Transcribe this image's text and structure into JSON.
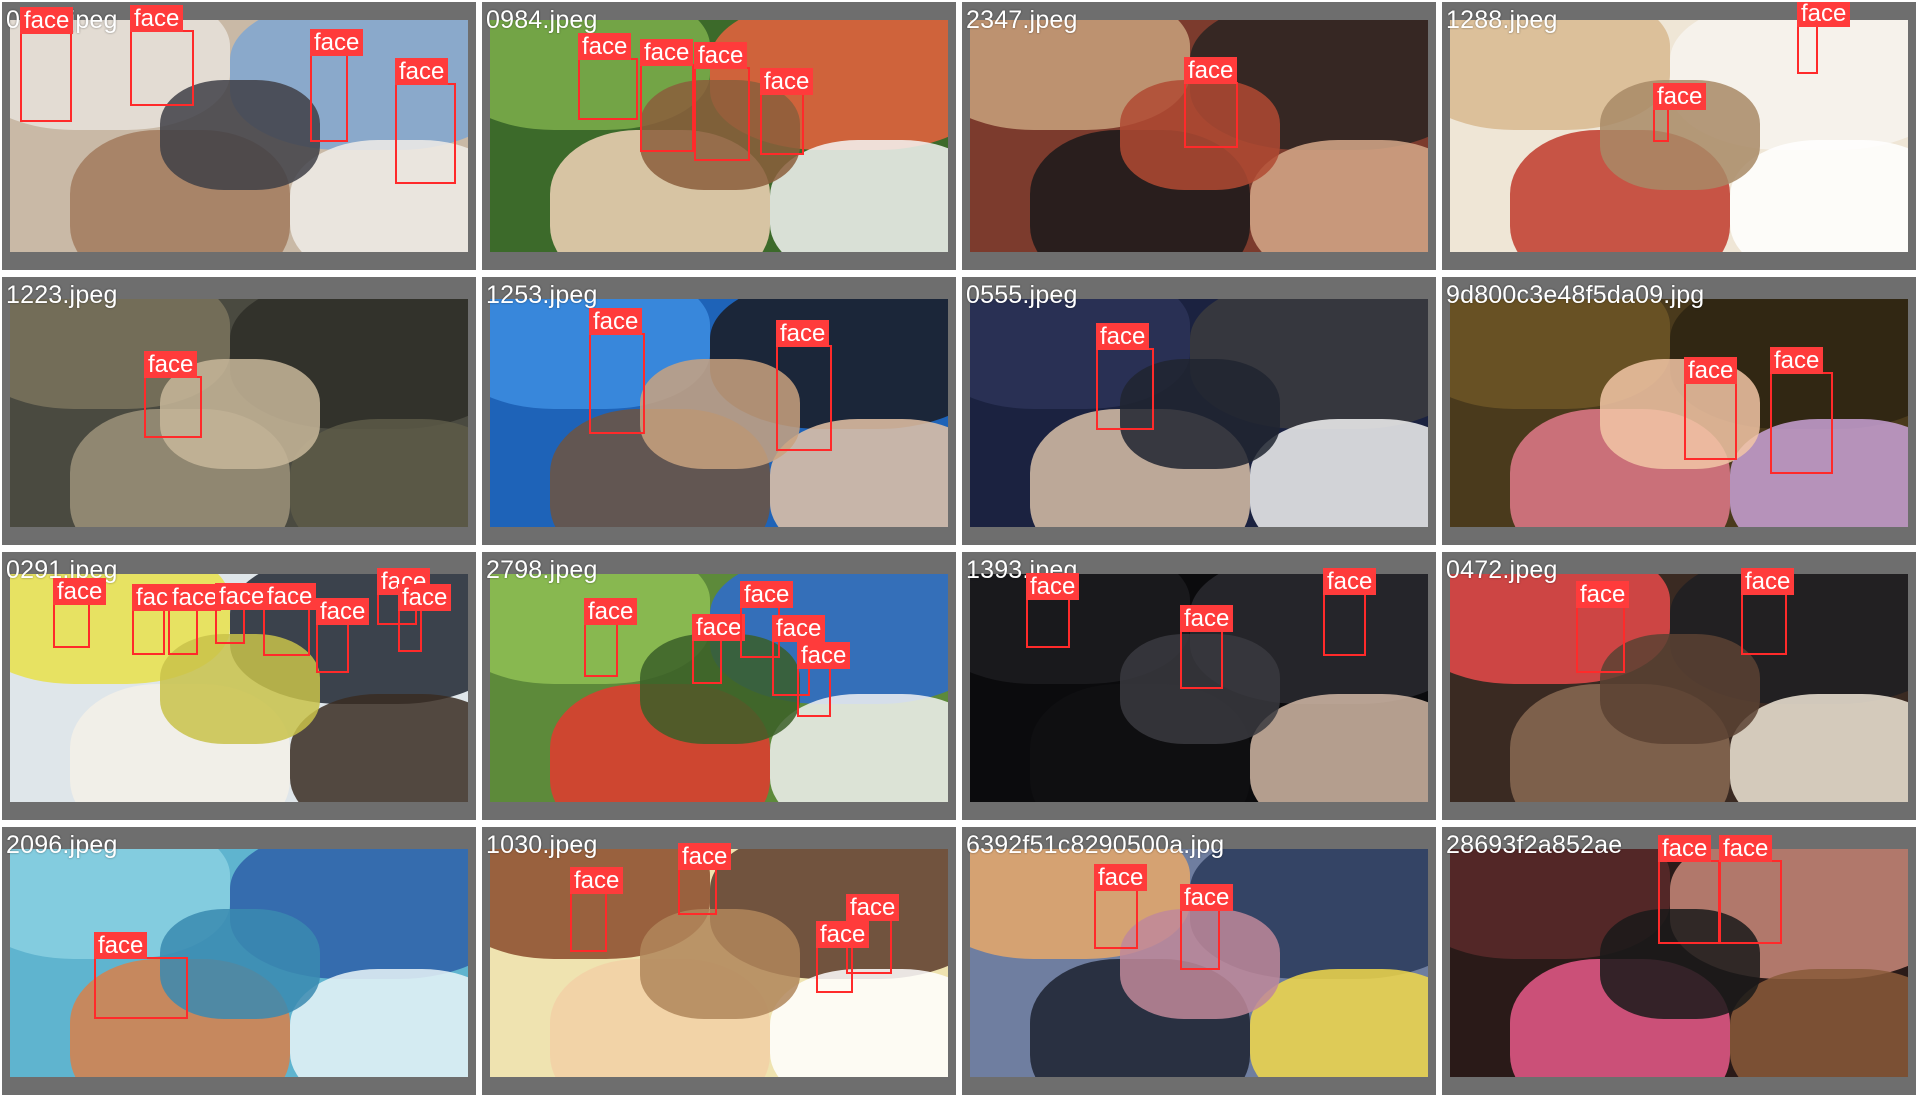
{
  "colors": {
    "frame": "#6e6e6e",
    "box": "#ff2a2a",
    "label_bg": "#ff3b3b",
    "label_text": "#ffffff"
  },
  "tiles": [
    {
      "filename": "0138.jpeg",
      "label": "face",
      "faces": 4,
      "scene": {
        "base": "#c9b9a6",
        "layers": [
          "#e8e2da",
          "#7fa6d1",
          "#a27a5d",
          "#f0ece7",
          "#3f3f46"
        ]
      }
    },
    {
      "filename": "0984.jpeg",
      "label": "face",
      "faces": 4,
      "scene": {
        "base": "#3c6a2a",
        "layers": [
          "#7cae4b",
          "#e9623e",
          "#f2d3b8",
          "#f4f4f4",
          "#8b5e3c"
        ]
      }
    },
    {
      "filename": "2347.jpeg",
      "label": "face",
      "faces": 1,
      "scene": {
        "base": "#7c3b2d",
        "layers": [
          "#c9a27d",
          "#2a2422",
          "#1b1a1b",
          "#d6a98a",
          "#b04a32"
        ]
      }
    },
    {
      "filename": "1288.jpeg",
      "label": "face",
      "faces": 2,
      "scene": {
        "base": "#efe6d6",
        "layers": [
          "#d8b98f",
          "#f7f3ee",
          "#c0392b",
          "#ffffff",
          "#a88a66"
        ]
      }
    },
    {
      "filename": "1223.jpeg",
      "label": "face",
      "faces": 1,
      "scene": {
        "base": "#4a4a40",
        "layers": [
          "#7a735d",
          "#2e2e28",
          "#9c927a",
          "#5d5a48",
          "#c8b79a"
        ]
      }
    },
    {
      "filename": "1253.jpeg",
      "label": "face",
      "faces": 2,
      "scene": {
        "base": "#1e63b8",
        "layers": [
          "#3d8de0",
          "#1b1b22",
          "#6e5440",
          "#e5c3a6",
          "#c9a27f"
        ]
      }
    },
    {
      "filename": "0555.jpeg",
      "label": "face",
      "faces": 1,
      "scene": {
        "base": "#1b2240",
        "layers": [
          "#2b3358",
          "#3b3b3e",
          "#d8c0a8",
          "#f2f2f2",
          "#202430"
        ]
      }
    },
    {
      "filename": "9d800c3e48f5da09.jpg",
      "label": "face",
      "faces": 2,
      "scene": {
        "base": "#4a3a1c",
        "layers": [
          "#6d5626",
          "#2d2412",
          "#e07a8a",
          "#c9a2d6",
          "#f2c6a6"
        ]
      }
    },
    {
      "filename": "0291.jpeg",
      "label": "face",
      "faces": 9,
      "scene": {
        "base": "#dfe6ea",
        "layers": [
          "#e9e14a",
          "#1f2530",
          "#f4f0e8",
          "#3a2c22",
          "#c9c24a"
        ]
      }
    },
    {
      "filename": "2798.jpeg",
      "label": "face",
      "faces": 6,
      "scene": {
        "base": "#5d8a3a",
        "layers": [
          "#8fbf55",
          "#2d6ad0",
          "#e23a2f",
          "#f2f2f2",
          "#3b5f28"
        ]
      }
    },
    {
      "filename": "1393.jpeg",
      "label": "face",
      "faces": 3,
      "scene": {
        "base": "#0b0b0d",
        "layers": [
          "#1c1c20",
          "#2a2a30",
          "#101013",
          "#d2b8a6",
          "#3a3a40"
        ]
      }
    },
    {
      "filename": "0472.jpeg",
      "label": "face",
      "faces": 2,
      "scene": {
        "base": "#3a2a22",
        "layers": [
          "#e84a4a",
          "#1e1e22",
          "#8a6a52",
          "#f0e6d6",
          "#5a4232"
        ]
      }
    },
    {
      "filename": "2096.jpeg",
      "label": "face",
      "faces": 1,
      "scene": {
        "base": "#5fb4cf",
        "layers": [
          "#8ad0e2",
          "#2e5fa8",
          "#d8804a",
          "#e9f5f8",
          "#3a8ab0"
        ]
      }
    },
    {
      "filename": "1030.jpeg",
      "label": "face",
      "faces": 5,
      "scene": {
        "base": "#efe3b0",
        "layers": [
          "#8a4a2a",
          "#5a3a2a",
          "#f2d0a6",
          "#ffffff",
          "#b0865a"
        ]
      }
    },
    {
      "filename": "6392f51c8290500a.jpg",
      "label": "face",
      "faces": 2,
      "scene": {
        "base": "#6f7ea0",
        "layers": [
          "#e8a86a",
          "#2a3a5a",
          "#1d2230",
          "#f2d84a",
          "#c0889a"
        ]
      }
    },
    {
      "filename": "28693f2a852ae",
      "label": "face",
      "faces": 2,
      "scene": {
        "base": "#2a1a18",
        "layers": [
          "#5a2a2a",
          "#c98a7a",
          "#e85a8a",
          "#8a5a3a",
          "#1a1a1a"
        ]
      }
    }
  ]
}
